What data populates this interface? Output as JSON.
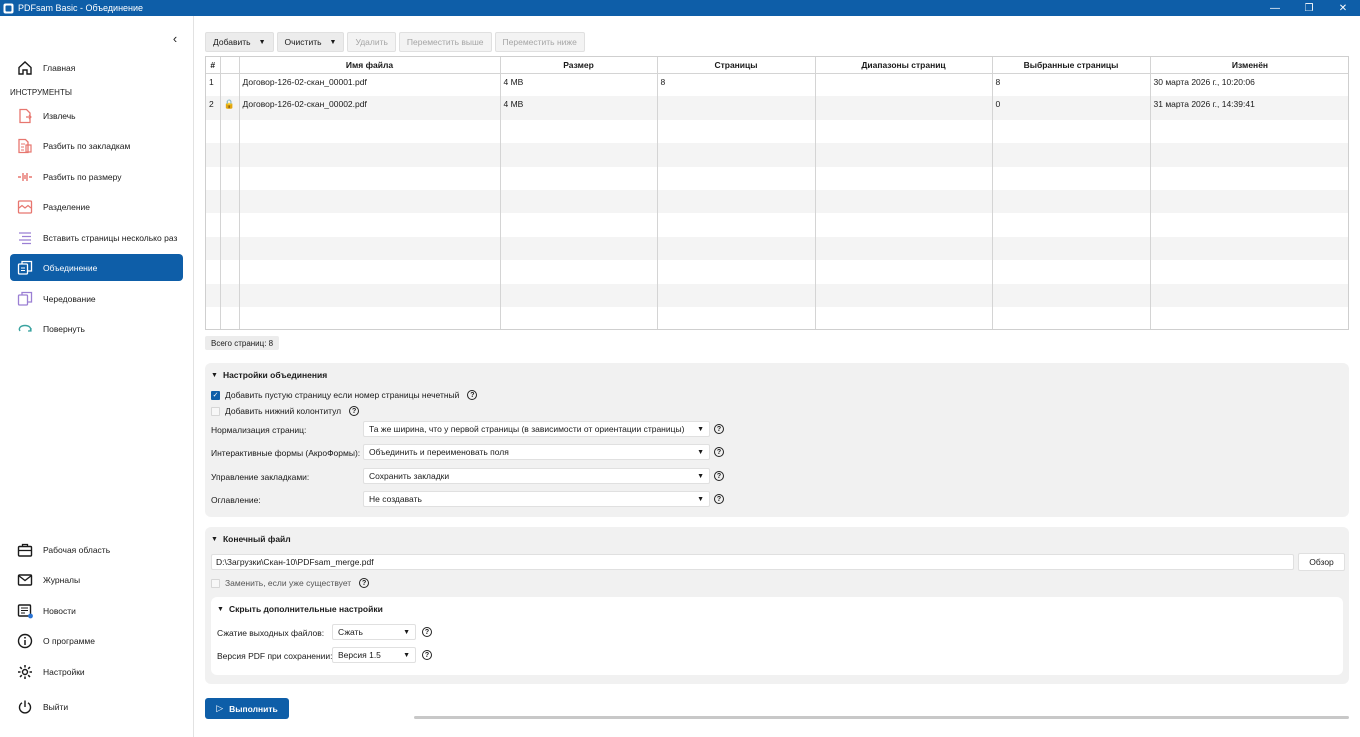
{
  "window": {
    "title": "PDFsam Basic - Объединение",
    "minimize": "—",
    "maximize": "❐",
    "close": "✕"
  },
  "sidebar": {
    "collapse": "‹",
    "home": "Главная",
    "tools_header": "ИНСТРУМЕНТЫ",
    "items": [
      {
        "label": "Извлечь",
        "icon": "extract-icon"
      },
      {
        "label": "Разбить по закладкам",
        "icon": "split-bookmarks-icon"
      },
      {
        "label": "Разбить по размеру",
        "icon": "split-size-icon"
      },
      {
        "label": "Разделение",
        "icon": "split-icon"
      },
      {
        "label": "Вставить страницы несколько раз",
        "icon": "insert-pages-icon"
      },
      {
        "label": "Объединение",
        "icon": "merge-icon",
        "active": true
      },
      {
        "label": "Чередование",
        "icon": "alternate-mix-icon"
      },
      {
        "label": "Повернуть",
        "icon": "rotate-icon"
      }
    ],
    "bottom": [
      {
        "label": "Рабочая область",
        "icon": "workspace-icon"
      },
      {
        "label": "Журналы",
        "icon": "logs-icon"
      },
      {
        "label": "Новости",
        "icon": "news-icon"
      },
      {
        "label": "О программе",
        "icon": "about-icon"
      },
      {
        "label": "Настройки",
        "icon": "settings-icon"
      },
      {
        "label": "Выйти",
        "icon": "exit-icon"
      }
    ]
  },
  "toolbar": {
    "add": "Добавить",
    "clear": "Очистить",
    "remove": "Удалить",
    "move_up": "Переместить выше",
    "move_down": "Переместить ниже"
  },
  "table": {
    "columns": [
      "#",
      "",
      "Имя файла",
      "Размер",
      "Страницы",
      "Диапазоны страниц",
      "Выбранные страницы",
      "Изменён"
    ],
    "rows": [
      {
        "num": "1",
        "lock": "",
        "name": "Договор-126-02-скан_00001.pdf",
        "size": "4 MB",
        "pages": "8",
        "ranges": "",
        "selected": "8",
        "modified": "30 марта 2026 г., 10:20:06"
      },
      {
        "num": "2",
        "lock": "🔒",
        "name": "Договор-126-02-скан_00002.pdf",
        "size": "4 MB",
        "pages": "",
        "ranges": "",
        "selected": "0",
        "modified": "31 марта 2026 г., 14:39:41"
      }
    ],
    "total_pages": "Всего страниц: 8"
  },
  "merge_settings": {
    "title": "Настройки объединения",
    "blank_page_label": "Добавить пустую страницу если номер страницы нечетный",
    "blank_page_checked": true,
    "footer_label": "Добавить нижний колонтитул",
    "footer_checked": false,
    "normalize_label": "Нормализация страниц:",
    "normalize_value": "Та же ширина, что у первой страницы (в зависимости от ориентации страницы)",
    "forms_label": "Интерактивные формы (АкроФормы):",
    "forms_value": "Объединить и переименовать поля",
    "bookmarks_label": "Управление закладками:",
    "bookmarks_value": "Сохранить закладки",
    "toc_label": "Оглавление:",
    "toc_value": "Не создавать"
  },
  "output": {
    "title": "Конечный файл",
    "path": "D:\\Загрузки\\Скан-10\\PDFsam_merge.pdf",
    "browse": "Обзор",
    "overwrite_label": "Заменить, если уже существует",
    "advanced_title": "Скрыть  дополнительные настройки",
    "compress_label": "Сжатие выходных файлов:",
    "compress_value": "Сжать",
    "version_label": "Версия PDF при сохранении:",
    "version_value": "Версия 1.5"
  },
  "run": "Выполнить",
  "help_glyph": "?"
}
